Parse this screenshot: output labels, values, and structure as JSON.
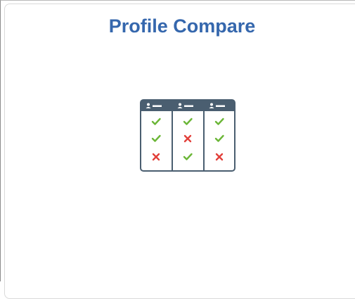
{
  "tile": {
    "title": "Profile Compare",
    "icon": "profile-compare-icon"
  },
  "colors": {
    "title": "#3567ad",
    "icon_frame": "#4a5e70",
    "check": "#6bb637",
    "cross": "#e2403b"
  },
  "icon_grid": {
    "columns": 3,
    "rows": [
      [
        "check",
        "check",
        "check"
      ],
      [
        "check",
        "cross",
        "check"
      ],
      [
        "cross",
        "check",
        "cross"
      ]
    ]
  }
}
